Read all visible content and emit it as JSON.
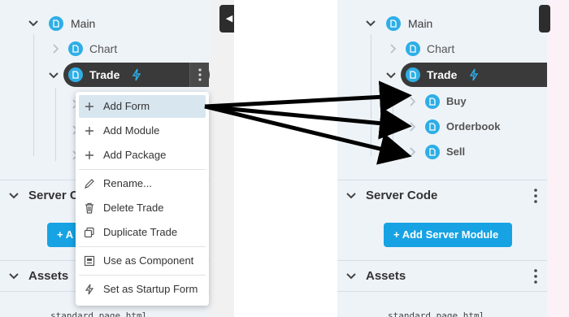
{
  "left": {
    "tree": {
      "main": "Main",
      "chart": "Chart",
      "trade": "Trade"
    },
    "server_code": {
      "title": "Server Co",
      "button": "+ A"
    },
    "assets": {
      "title": "Assets",
      "file": "standard_page.html"
    }
  },
  "context_menu": {
    "items": [
      {
        "label": "Add Form",
        "icon": "plus-icon"
      },
      {
        "label": "Add Module",
        "icon": "plus-icon"
      },
      {
        "label": "Add Package",
        "icon": "plus-icon"
      },
      {
        "label": "Rename...",
        "icon": "pencil-icon"
      },
      {
        "label": "Delete Trade",
        "icon": "trash-icon"
      },
      {
        "label": "Duplicate Trade",
        "icon": "duplicate-icon"
      },
      {
        "label": "Use as Component",
        "icon": "component-icon"
      },
      {
        "label": "Set as Startup Form",
        "icon": "lightning-icon"
      }
    ]
  },
  "right": {
    "tree": {
      "main": "Main",
      "chart": "Chart",
      "trade": "Trade",
      "children": [
        "Buy",
        "Orderbook",
        "Sell"
      ]
    },
    "server_code": {
      "title": "Server Code",
      "button": "+  Add Server Module"
    },
    "assets": {
      "title": "Assets",
      "file": "standard_page.html"
    }
  },
  "colors": {
    "accent": "#17a2e3",
    "selected_bg": "#3a3a3a",
    "panel_bg": "#eef3f8"
  }
}
